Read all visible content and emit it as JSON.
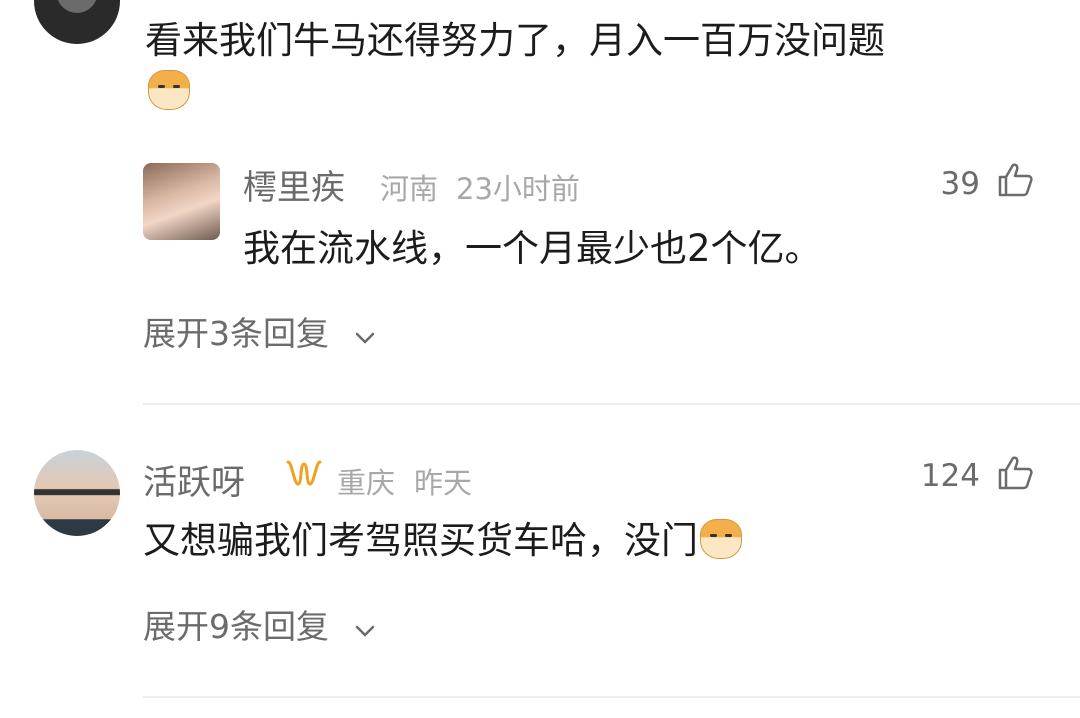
{
  "comments": [
    {
      "text": "看来我们牛马还得努力了，月入一百万没问题",
      "emoji": "doge-emoji"
    },
    {
      "username": "樗里疾",
      "location": "河南",
      "time": "23小时前",
      "likes": "39",
      "text": "我在流水线，一个月最少也2个亿。"
    },
    {
      "username": "活跃呀",
      "badge": "ʊʊ",
      "location": "重庆",
      "time": "昨天",
      "likes": "124",
      "text": "又想骗我们考驾照买货车哈，没门",
      "emoji": "doge-emoji"
    }
  ],
  "expand1": "展开3条回复",
  "expand2": "展开9条回复",
  "colors": {
    "username": "#6b6b6b",
    "meta": "#a8a8a8",
    "badge": "#f0a020"
  }
}
